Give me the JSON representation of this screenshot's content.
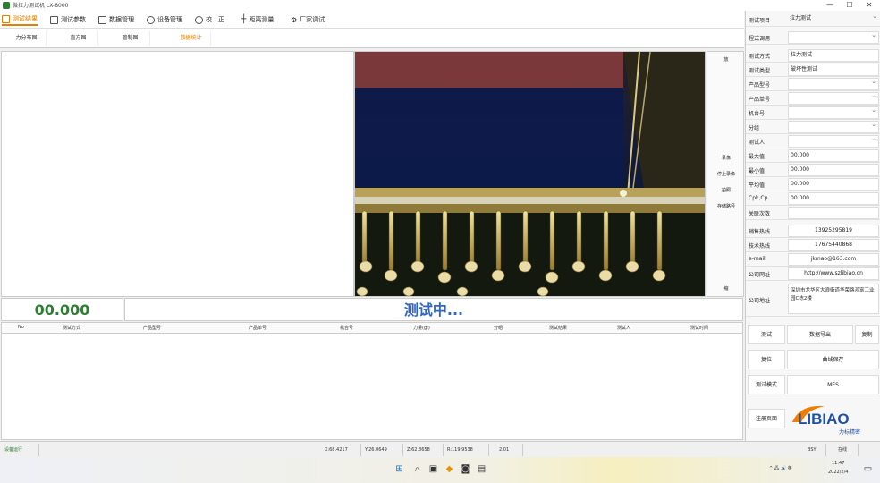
{
  "window": {
    "title": "微拉力测试机 LX-8000",
    "controls": [
      "—",
      "☐",
      "✕"
    ]
  },
  "menu": [
    {
      "label": "测试结果",
      "icon": "chart-icon",
      "active": true
    },
    {
      "label": "测试参数",
      "icon": "sliders-icon"
    },
    {
      "label": "数据管理",
      "icon": "database-icon"
    },
    {
      "label": "设备管理",
      "icon": "wrench-icon"
    },
    {
      "label": "校　正",
      "icon": "refresh-icon"
    },
    {
      "label": "距离测量",
      "icon": "crosshair-icon"
    },
    {
      "label": "厂家调试",
      "icon": "gears-icon"
    }
  ],
  "subtabs": [
    "力分布图",
    "直方图",
    "管制图",
    "数据统计"
  ],
  "active_subtab_index": 3,
  "camera_controls": {
    "top": "放",
    "buttons": [
      "录像",
      "停止录像",
      "拍照",
      "存储路径"
    ],
    "bottom": "缩"
  },
  "reading": {
    "value": "00.000",
    "status": "测试中..."
  },
  "table": {
    "columns": [
      "No",
      "测试方式",
      "产品型号",
      "产品单号",
      "机台号",
      "力量(gf)",
      "分组",
      "测试结果",
      "测试人",
      "测试时间"
    ]
  },
  "right_panel": {
    "test_item_label": "测试项目",
    "test_item_value": "拉力测试",
    "program_call_label": "程式调用",
    "program_call_value": "",
    "fields": [
      {
        "label": "测试方式",
        "value": "拉力测试"
      },
      {
        "label": "测试类型",
        "value": "破坏性测试"
      },
      {
        "label": "产品型号",
        "value": "",
        "select": true
      },
      {
        "label": "产品单号",
        "value": "",
        "select": true
      },
      {
        "label": "机台号",
        "value": "",
        "select": true
      },
      {
        "label": "分组",
        "value": "",
        "select": true
      },
      {
        "label": "测试人",
        "value": "",
        "select": true
      },
      {
        "label": "最大值",
        "value": "00.000"
      },
      {
        "label": "最小值",
        "value": "00.000"
      },
      {
        "label": "平均值",
        "value": "00.000"
      },
      {
        "label": "Cpk,Cp",
        "value": "00.000"
      },
      {
        "label": "关联次数",
        "value": ""
      },
      {
        "label": "销售热线",
        "value": "13925295819",
        "center": true
      },
      {
        "label": "技术热线",
        "value": "17675440868",
        "center": true
      },
      {
        "label": "e-mail",
        "value": "jkmao@163.com",
        "center": true
      },
      {
        "label": "公司网址",
        "value": "http://www.szlibiao.cn",
        "center": true
      }
    ],
    "address_label": "公司地址",
    "address_value": "深圳市龙华区大浪街道华荣路鸿富工业园C栋2楼",
    "buttons": {
      "test": "测试",
      "export": "数据导出",
      "copy": "复制",
      "reset": "复位",
      "save_curve": "曲线保存",
      "mode": "测试模式",
      "mes": "MES",
      "register": "注册页面"
    },
    "logo_text": "LIBIAO",
    "logo_sub": "力标精密"
  },
  "statusbar": {
    "state": "设备运行",
    "x": "X:68.4217",
    "y": "Y:26.0649",
    "z": "Z:62.8658",
    "r": "R:119.9538",
    "num": "2.01",
    "code": "BSY",
    "online": "在线"
  },
  "taskbar": {
    "tray_text": "^ 🖧 🔊 英",
    "time": "11:47",
    "date": "2022/2/4"
  }
}
